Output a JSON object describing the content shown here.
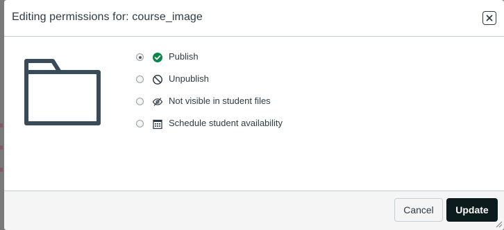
{
  "dialog": {
    "title": "Editing permissions for: course_image",
    "close_icon": "close-icon"
  },
  "preview": {
    "icon": "folder-icon"
  },
  "options": [
    {
      "label": "Publish",
      "icon": "published-check-icon",
      "checked": true
    },
    {
      "label": "Unpublish",
      "icon": "unpublish-icon",
      "checked": false
    },
    {
      "label": "Not visible in student files",
      "icon": "eye-slash-icon",
      "checked": false
    },
    {
      "label": "Schedule student availability",
      "icon": "calendar-icon",
      "checked": false
    }
  ],
  "footer": {
    "cancel_label": "Cancel",
    "update_label": "Update"
  },
  "colors": {
    "text": "#2d3b45",
    "publish_green": "#0b874b",
    "update_button": "#0c1b1c"
  }
}
